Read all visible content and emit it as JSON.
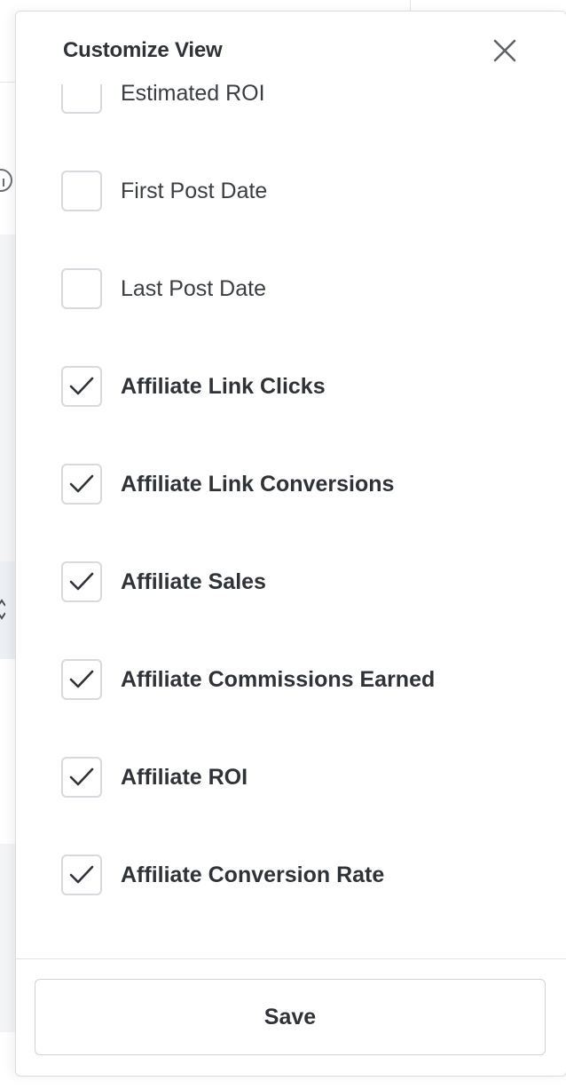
{
  "panel": {
    "title": "Customize View",
    "close_icon": "close-icon"
  },
  "options": [
    {
      "label": "Estimated ROI",
      "checked": false
    },
    {
      "label": "First Post Date",
      "checked": false
    },
    {
      "label": "Last Post Date",
      "checked": false
    },
    {
      "label": "Affiliate Link Clicks",
      "checked": true
    },
    {
      "label": "Affiliate Link Conversions",
      "checked": true
    },
    {
      "label": "Affiliate Sales",
      "checked": true
    },
    {
      "label": "Affiliate Commissions Earned",
      "checked": true
    },
    {
      "label": "Affiliate ROI",
      "checked": true
    },
    {
      "label": "Affiliate Conversion Rate",
      "checked": true
    }
  ],
  "footer": {
    "save_label": "Save"
  },
  "colors": {
    "text": "#2f3337",
    "border": "#d6d9dd",
    "checkmark": "#2f3337"
  }
}
